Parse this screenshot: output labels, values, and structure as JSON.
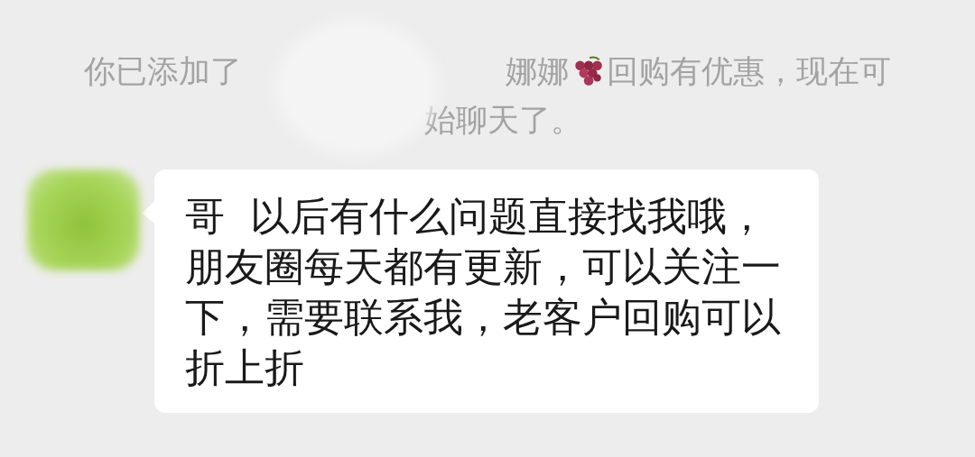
{
  "notice": {
    "before_name": "你已添加了",
    "name_end": "娜娜",
    "after_name": "回购有优惠，现在可",
    "second_line": "始聊天了。"
  },
  "messages": [
    {
      "text": "哥  以后有什么问题直接找我哦，朋友圈每天都有更新，可以关注一下，需要联系我，老客户回购可以折上折"
    }
  ]
}
